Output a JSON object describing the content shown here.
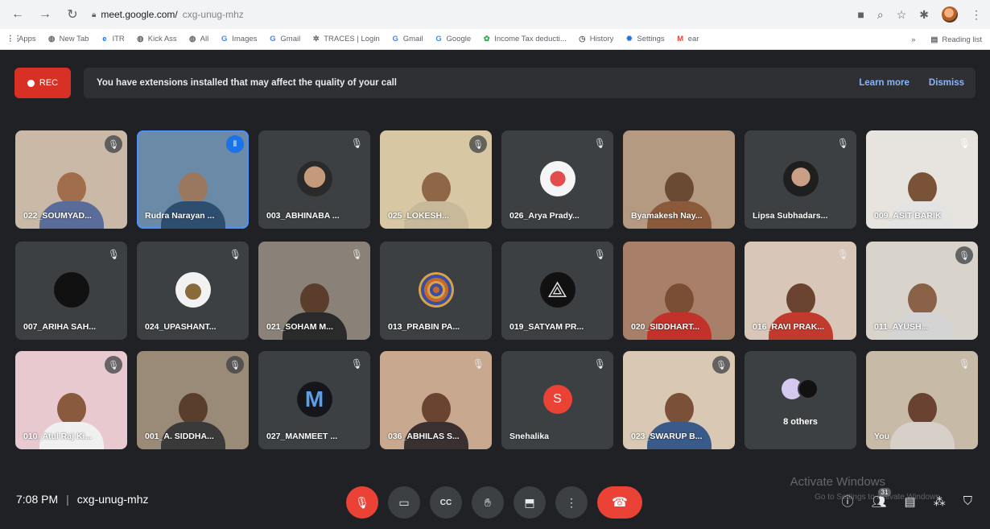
{
  "browser": {
    "url_host": "meet.google.com/",
    "url_path": "cxg-unug-mhz",
    "bookmarks": [
      "Apps",
      "New Tab",
      "ITR",
      "Kick Ass",
      "All",
      "Images",
      "Gmail",
      "TRACES | Login",
      "Gmail",
      "Google",
      "Income Tax deducti...",
      "History",
      "Settings",
      "ear"
    ],
    "reading_list": "Reading list"
  },
  "banner": {
    "rec_label": "REC",
    "message": "You have extensions installed that may affect the quality of your call",
    "learn_more": "Learn more",
    "dismiss": "Dismiss"
  },
  "tiles": [
    {
      "name": "022_SOUMYAD...",
      "mic": "muted"
    },
    {
      "name": "Rudra Narayan ...",
      "mic": "speaking"
    },
    {
      "name": "003_ABHINABA ...",
      "mic": "muted"
    },
    {
      "name": "025_LOKESH...",
      "mic": "muted"
    },
    {
      "name": "026_Arya Prady...",
      "mic": "muted"
    },
    {
      "name": "Byamakesh Nay...",
      "mic": "muted"
    },
    {
      "name": "Lipsa Subhadars...",
      "mic": "muted"
    },
    {
      "name": "009_ASIT BARIK",
      "mic": "muted"
    },
    {
      "name": "007_ARIHA SAH...",
      "mic": "muted"
    },
    {
      "name": "024_UPASHANT...",
      "mic": "muted"
    },
    {
      "name": "021_SOHAM M...",
      "mic": "muted"
    },
    {
      "name": "013_PRABIN PA...",
      "mic": "muted"
    },
    {
      "name": "019_SATYAM PR...",
      "mic": "muted"
    },
    {
      "name": "020_SIDDHART...",
      "mic": "muted"
    },
    {
      "name": "016_RAVI PRAK...",
      "mic": "muted"
    },
    {
      "name": "011_AYUSH...",
      "mic": "muted"
    },
    {
      "name": "010_Atul Raj Ki...",
      "mic": "muted"
    },
    {
      "name": "001_A. SIDDHA...",
      "mic": "muted"
    },
    {
      "name": "027_MANMEET ...",
      "mic": "muted"
    },
    {
      "name": "036_ABHILAS S...",
      "mic": "muted"
    },
    {
      "name": "Snehalika",
      "mic": "muted",
      "initial": "S"
    },
    {
      "name": "023_SWARUP B...",
      "mic": "muted"
    },
    {
      "name": "8 others",
      "mic": "none"
    },
    {
      "name": "You",
      "mic": "muted"
    }
  ],
  "bottom": {
    "time": "7:08 PM",
    "meeting_code": "cxg-unug-mhz",
    "participants_count": "31",
    "watermark_title": "Activate Windows",
    "watermark_sub": "Go to Settings to activate Windows."
  },
  "colors": {
    "accent_blue": "#8ab4f8",
    "rec_red": "#d93025",
    "meet_bg": "#202124",
    "tile_bg": "#3c4043"
  }
}
